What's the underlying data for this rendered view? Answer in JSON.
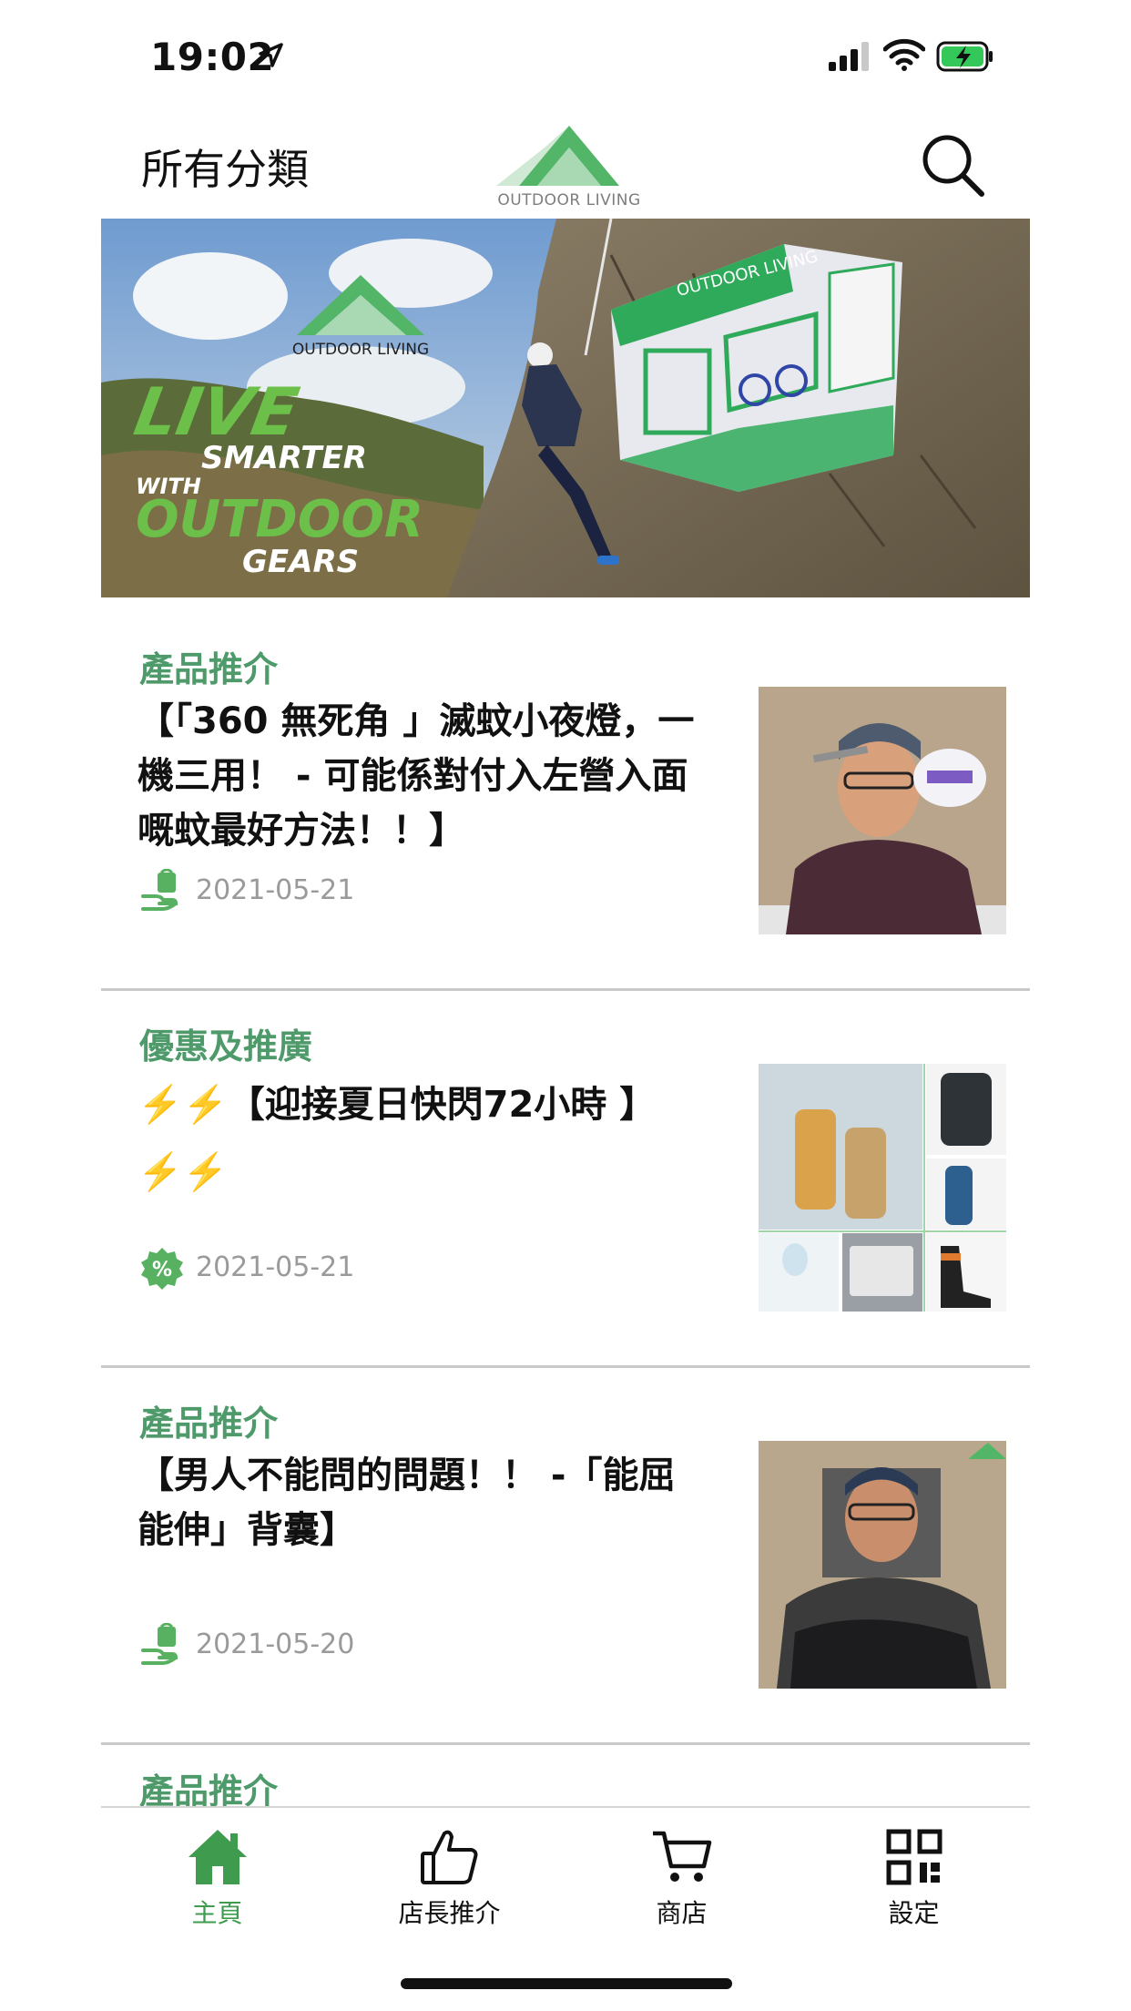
{
  "status_bar": {
    "time": "19:02"
  },
  "header": {
    "all_categories": "所有分類",
    "logo_text": "OUTDOOR LIVING"
  },
  "banner": {
    "logo_text": "OUTDOOR LIVING",
    "cube_text": "OUTDOOR LIVING",
    "slogan_live": "LIVE",
    "slogan_smarter": "SMARTER",
    "slogan_with": "WITH",
    "slogan_outdoor": "OUTDOOR",
    "slogan_gears": "GEARS"
  },
  "articles": [
    {
      "category": "產品推介",
      "title": "【「360 無死角 」滅蚊小夜燈，一機三用！ - 可能係對付入左營入面嘅蚊最好方法！！】",
      "date": "2021-05-21",
      "icon": "bag-hand-icon"
    },
    {
      "category": "優惠及推廣",
      "title": "⚡️⚡️【迎接夏日快閃72小時 】⚡️⚡️",
      "date": "2021-05-21",
      "icon": "percent-badge-icon"
    },
    {
      "category": "產品推介",
      "title": "【男人不能問的問題！！ -「能屈能伸」背囊】",
      "date": "2021-05-20",
      "icon": "bag-hand-icon"
    },
    {
      "category": "產品推介"
    }
  ],
  "bottom_nav": [
    {
      "label": "主頁",
      "icon": "home-icon",
      "active": true
    },
    {
      "label": "店長推介",
      "icon": "thumbs-up-icon",
      "active": false
    },
    {
      "label": "商店",
      "icon": "cart-icon",
      "active": false
    },
    {
      "label": "設定",
      "icon": "grid-icon",
      "active": false
    }
  ],
  "colors": {
    "brand_green": "#4f9a6a",
    "active_nav": "#3f9b4d",
    "date_gray": "#9a9a9a",
    "divider": "#c9c9c9"
  }
}
